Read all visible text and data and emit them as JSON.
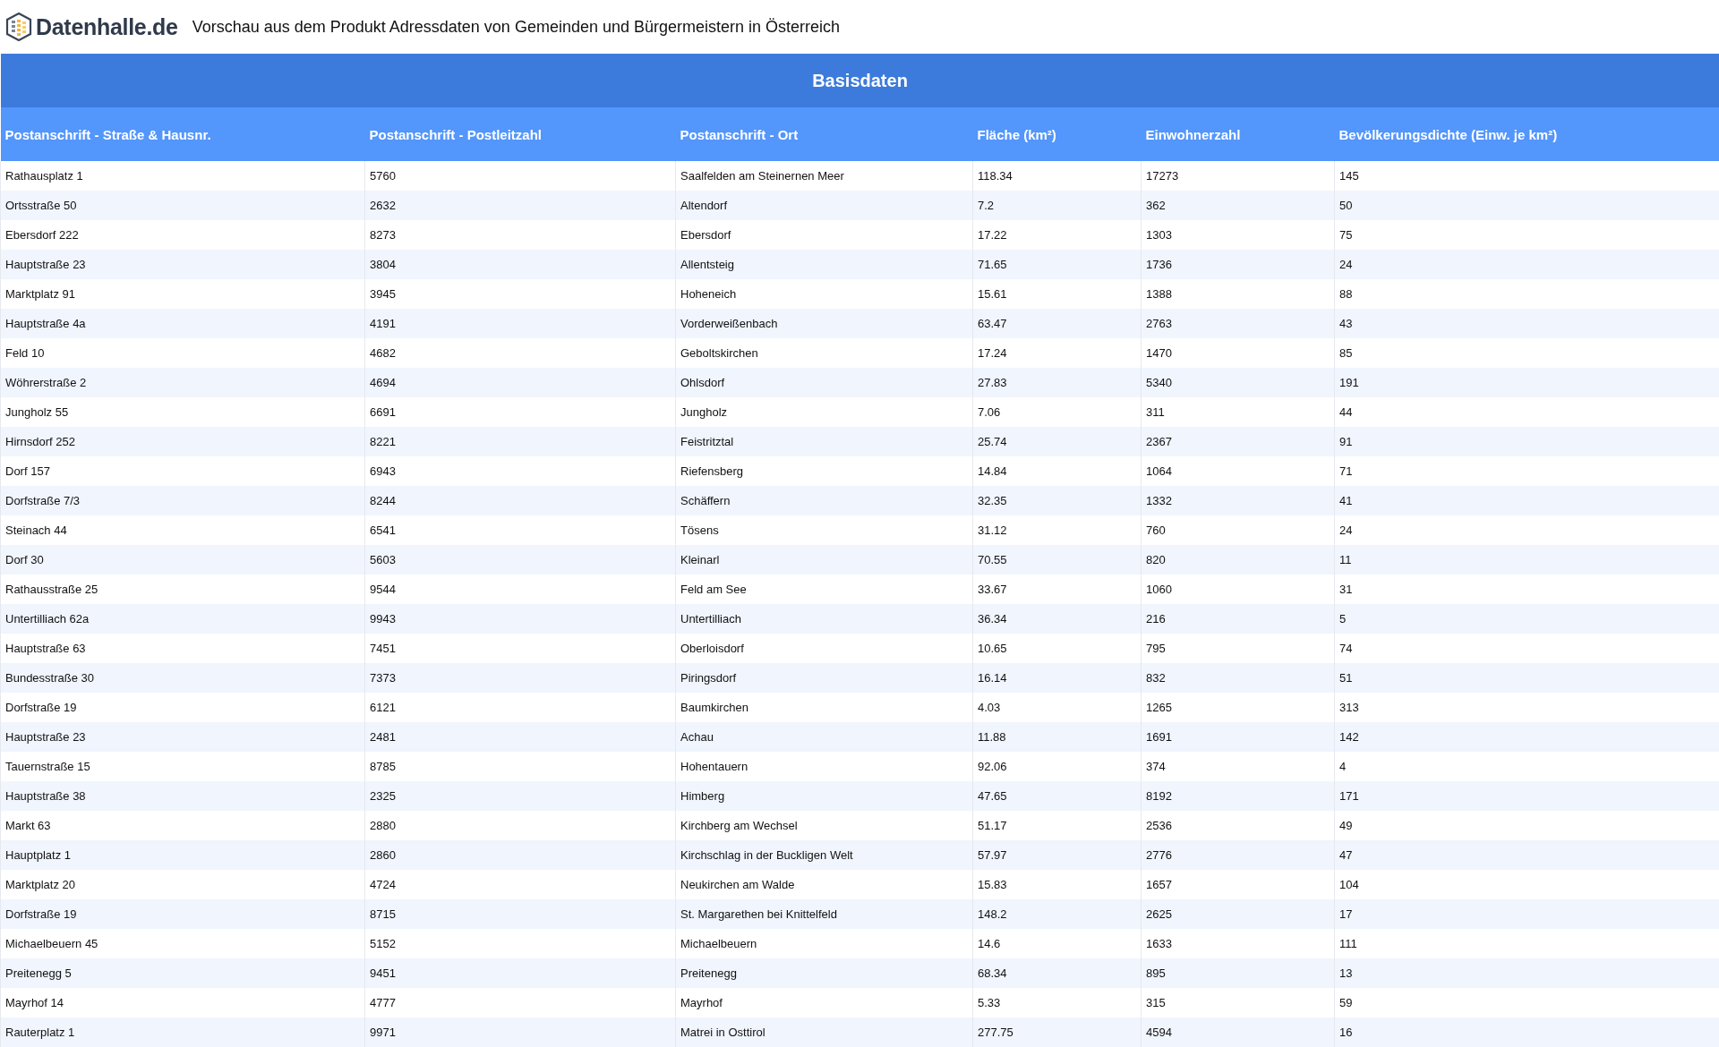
{
  "header": {
    "logo_text": "Datenhalle.de",
    "title": "Vorschau aus dem Produkt Adressdaten von Gemeinden und Bürgermeistern in Österreich"
  },
  "table": {
    "group_title": "Basisdaten",
    "columns": [
      "Postanschrift - Straße & Hausnr.",
      "Postanschrift - Postleitzahl",
      "Postanschrift - Ort",
      "Fläche (km²)",
      "Einwohnerzahl",
      "Bevölkerungsdichte (Einw. je km²)"
    ],
    "rows": [
      [
        "Rathausplatz 1",
        "5760",
        "Saalfelden am Steinernen Meer",
        "118.34",
        "17273",
        "145"
      ],
      [
        "Ortsstraße 50",
        "2632",
        "Altendorf",
        "7.2",
        "362",
        "50"
      ],
      [
        "Ebersdorf 222",
        "8273",
        "Ebersdorf",
        "17.22",
        "1303",
        "75"
      ],
      [
        "Hauptstraße 23",
        "3804",
        "Allentsteig",
        "71.65",
        "1736",
        "24"
      ],
      [
        "Marktplatz 91",
        "3945",
        "Hoheneich",
        "15.61",
        "1388",
        "88"
      ],
      [
        "Hauptstraße 4a",
        "4191",
        "Vorderweißenbach",
        "63.47",
        "2763",
        "43"
      ],
      [
        "Feld 10",
        "4682",
        "Geboltskirchen",
        "17.24",
        "1470",
        "85"
      ],
      [
        "Wöhrerstraße 2",
        "4694",
        "Ohlsdorf",
        "27.83",
        "5340",
        "191"
      ],
      [
        "Jungholz 55",
        "6691",
        "Jungholz",
        "7.06",
        "311",
        "44"
      ],
      [
        "Hirnsdorf 252",
        "8221",
        "Feistritztal",
        "25.74",
        "2367",
        "91"
      ],
      [
        "Dorf 157",
        "6943",
        "Riefensberg",
        "14.84",
        "1064",
        "71"
      ],
      [
        "Dorfstraße 7/3",
        "8244",
        "Schäffern",
        "32.35",
        "1332",
        "41"
      ],
      [
        "Steinach 44",
        "6541",
        "Tösens",
        "31.12",
        "760",
        "24"
      ],
      [
        "Dorf 30",
        "5603",
        "Kleinarl",
        "70.55",
        "820",
        "11"
      ],
      [
        "Rathausstraße 25",
        "9544",
        "Feld am See",
        "33.67",
        "1060",
        "31"
      ],
      [
        "Untertilliach 62a",
        "9943",
        "Untertilliach",
        "36.34",
        "216",
        "5"
      ],
      [
        "Hauptstraße 63",
        "7451",
        "Oberloisdorf",
        "10.65",
        "795",
        "74"
      ],
      [
        "Bundesstraße 30",
        "7373",
        "Piringsdorf",
        "16.14",
        "832",
        "51"
      ],
      [
        "Dorfstraße 19",
        "6121",
        "Baumkirchen",
        "4.03",
        "1265",
        "313"
      ],
      [
        "Hauptstraße 23",
        "2481",
        "Achau",
        "11.88",
        "1691",
        "142"
      ],
      [
        "Tauernstraße 15",
        "8785",
        "Hohentauern",
        "92.06",
        "374",
        "4"
      ],
      [
        "Hauptstraße 38",
        "2325",
        "Himberg",
        "47.65",
        "8192",
        "171"
      ],
      [
        "Markt 63",
        "2880",
        "Kirchberg am Wechsel",
        "51.17",
        "2536",
        "49"
      ],
      [
        "Hauptplatz 1",
        "2860",
        "Kirchschlag in der Buckligen Welt",
        "57.97",
        "2776",
        "47"
      ],
      [
        "Marktplatz 20",
        "4724",
        "Neukirchen am Walde",
        "15.83",
        "1657",
        "104"
      ],
      [
        "Dorfstraße 19",
        "8715",
        "St. Margarethen bei Knittelfeld",
        "148.2",
        "2625",
        "17"
      ],
      [
        "Michaelbeuern 45",
        "5152",
        "Michaelbeuern",
        "14.6",
        "1633",
        "111"
      ],
      [
        "Preitenegg 5",
        "9451",
        "Preitenegg",
        "68.34",
        "895",
        "13"
      ],
      [
        "Mayrhof 14",
        "4777",
        "Mayrhof",
        "5.33",
        "315",
        "59"
      ],
      [
        "Rauterplatz 1",
        "9971",
        "Matrei in Osttirol",
        "277.75",
        "4594",
        "16"
      ]
    ]
  }
}
